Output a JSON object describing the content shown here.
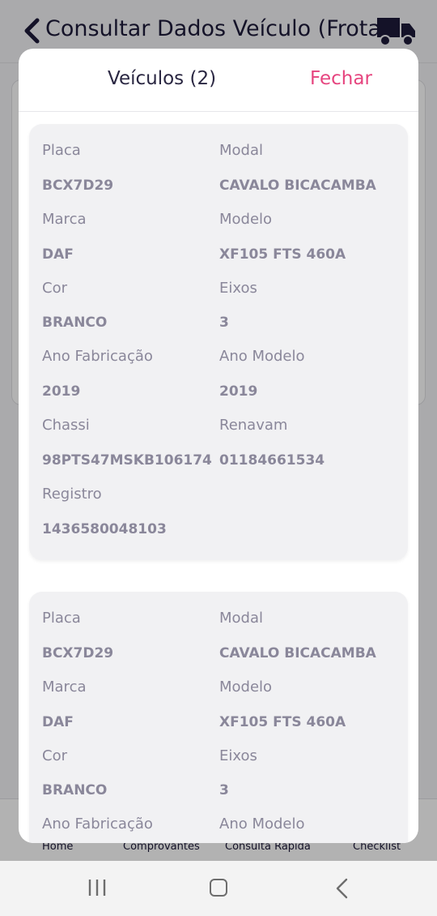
{
  "app": {
    "title": "Consultar Dados Veículo (Frota)",
    "nav": [
      "Home",
      "Comprovantes",
      "Consulta Rápida",
      "Checklist"
    ]
  },
  "modal": {
    "title": "Veículos (2)",
    "close_label": "Fechar"
  },
  "labels": {
    "placa": "Placa",
    "modal": "Modal",
    "marca": "Marca",
    "modelo": "Modelo",
    "cor": "Cor",
    "eixos": "Eixos",
    "ano_fabricacao": "Ano Fabricação",
    "ano_modelo": "Ano Modelo",
    "chassi": "Chassi",
    "renavam": "Renavam",
    "registro": "Registro"
  },
  "vehicles": [
    {
      "placa": "BCX7D29",
      "modal": "CAVALO BICACAMBA",
      "marca": "DAF",
      "modelo": "XF105 FTS 460A",
      "cor": "BRANCO",
      "eixos": "3",
      "ano_fabricacao": "2019",
      "ano_modelo": "2019",
      "chassi": "98PTS47MSKB106174",
      "renavam": "01184661534",
      "registro": "1436580048103"
    },
    {
      "placa": "BCX7D29",
      "modal": "CAVALO BICACAMBA",
      "marca": "DAF",
      "modelo": "XF105 FTS 460A",
      "cor": "BRANCO",
      "eixos": "3"
    }
  ],
  "colors": {
    "accent": "#e6457f",
    "title": "#2a2742",
    "text_muted": "#8a879a",
    "card_bg": "#f1f1f3"
  },
  "icons": {
    "back": "chevron-left-icon",
    "truck": "truck-icon",
    "recents": "recent-apps-icon",
    "home": "home-icon",
    "system_back": "back-icon"
  }
}
